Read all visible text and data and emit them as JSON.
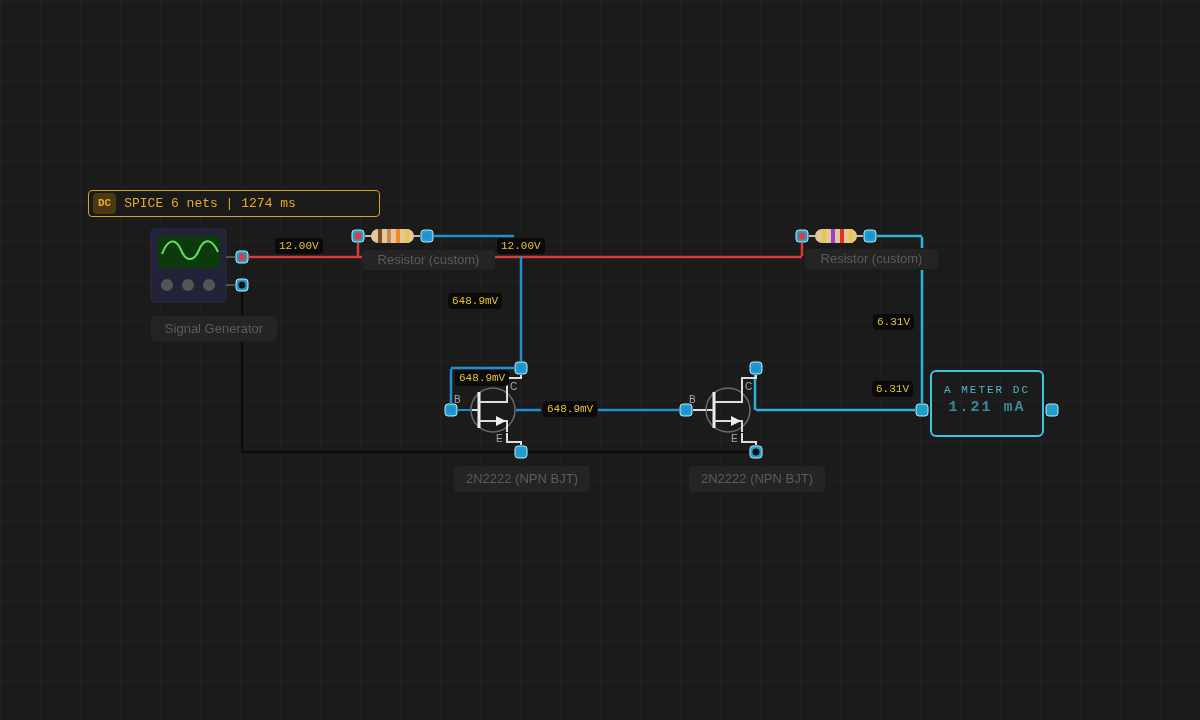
{
  "status_badge": {
    "mode": "DC",
    "text": "SPICE 6 nets | 1274 ms"
  },
  "signal_generator": {
    "label": "Signal Generator"
  },
  "resistors": [
    {
      "label": "Resistor (custom)"
    },
    {
      "label": "Resistor (custom)"
    }
  ],
  "transistors": [
    {
      "label": "2N2222 (NPN BJT)",
      "pins": [
        "B",
        "C",
        "E"
      ]
    },
    {
      "label": "2N2222 (NPN BJT)",
      "pins": [
        "B",
        "C",
        "E"
      ]
    }
  ],
  "meter": {
    "title": "A METER DC",
    "reading": "1.21 mA"
  },
  "voltage_labels": [
    "12.00V",
    "12.00V",
    "648.9mV",
    "648.9mV",
    "648.9mV",
    "6.31V",
    "6.31V"
  ]
}
